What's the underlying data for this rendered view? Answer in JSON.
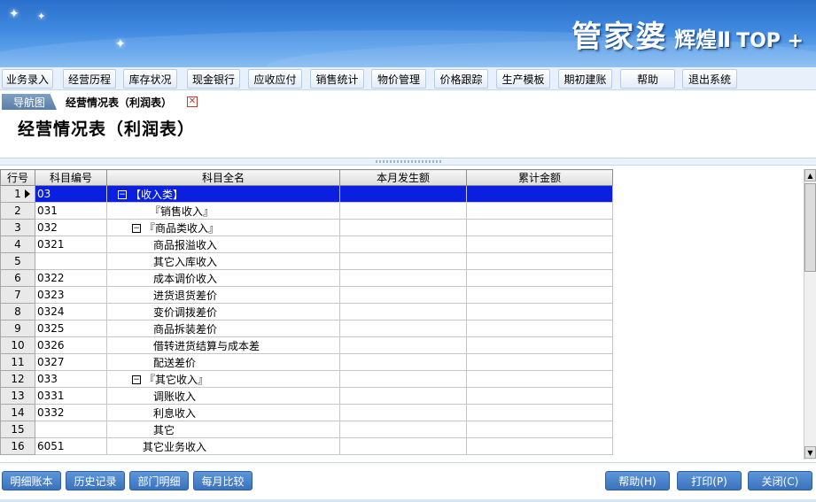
{
  "brand": {
    "main": "管家婆",
    "sub": "辉煌Ⅱ",
    "top": "TOP +"
  },
  "menu": [
    "业务录入",
    "经营历程",
    "库存状况",
    "现金银行",
    "应收应付",
    "销售统计",
    "物价管理",
    "价格跟踪",
    "生产模板",
    "期初建账",
    "帮助",
    "退出系统"
  ],
  "tabs": {
    "nav": "导航图",
    "active": "经营情况表（利润表）",
    "close_icon": "close-icon"
  },
  "page_title": "经营情况表（利润表）",
  "table": {
    "headers": [
      "行号",
      "科目编号",
      "科目全名",
      "本月发生额",
      "累计金额"
    ],
    "rows": [
      {
        "no": "1",
        "code": "03",
        "toggle": "⊟",
        "name": "【收入类】"
      },
      {
        "no": "2",
        "code": "031",
        "toggle": "",
        "name": "『销售收入』"
      },
      {
        "no": "3",
        "code": "032",
        "toggle": "⊟",
        "name": "『商品类收入』"
      },
      {
        "no": "4",
        "code": "0321",
        "toggle": "",
        "name": "商品报溢收入"
      },
      {
        "no": "5",
        "code": "",
        "toggle": "",
        "name": "其它入库收入"
      },
      {
        "no": "6",
        "code": "0322",
        "toggle": "",
        "name": "成本调价收入"
      },
      {
        "no": "7",
        "code": "0323",
        "toggle": "",
        "name": "进货退货差价"
      },
      {
        "no": "8",
        "code": "0324",
        "toggle": "",
        "name": "变价调拨差价"
      },
      {
        "no": "9",
        "code": "0325",
        "toggle": "",
        "name": "商品拆装差价"
      },
      {
        "no": "10",
        "code": "0326",
        "toggle": "",
        "name": "借转进货结算与成本差"
      },
      {
        "no": "11",
        "code": "0327",
        "toggle": "",
        "name": "配送差价"
      },
      {
        "no": "12",
        "code": "033",
        "toggle": "⊟",
        "name": "『其它收入』"
      },
      {
        "no": "13",
        "code": "0331",
        "toggle": "",
        "name": "调账收入"
      },
      {
        "no": "14",
        "code": "0332",
        "toggle": "",
        "name": "利息收入"
      },
      {
        "no": "15",
        "code": "",
        "toggle": "",
        "name": "其它"
      },
      {
        "no": "16",
        "code": "6051",
        "toggle": "",
        "name": "其它业务收入"
      }
    ]
  },
  "bottom_left": [
    "明细账本",
    "历史记录",
    "部门明细",
    "每月比较"
  ],
  "bottom_right": [
    "帮助(H)",
    "打印(P)",
    "关闭(C)"
  ],
  "colors": {
    "selection": "#0a1fe0",
    "banner": "#3d86de",
    "button": "#3a73bd"
  }
}
